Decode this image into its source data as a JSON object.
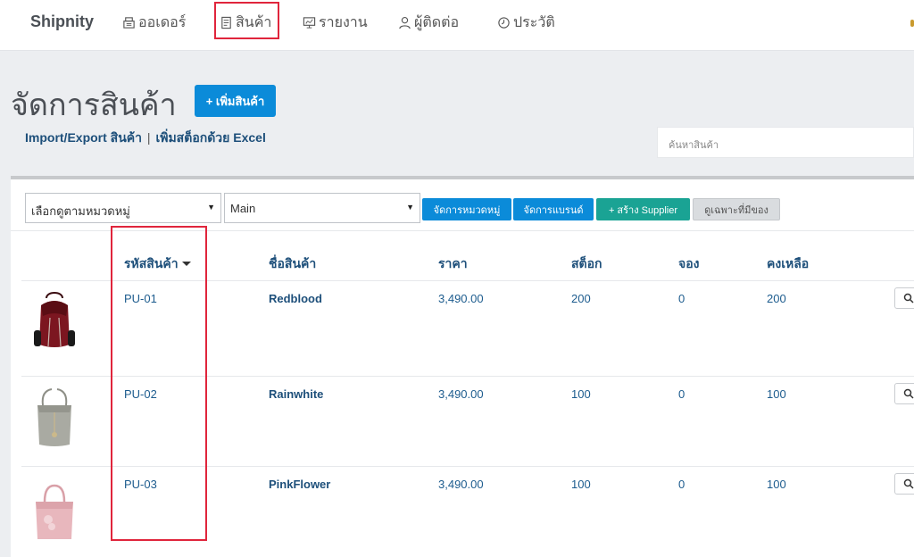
{
  "nav": {
    "brand": "Shipnity",
    "items": [
      {
        "label": "ออเดอร์",
        "icon": "cash-register-icon"
      },
      {
        "label": "สินค้า",
        "icon": "product-icon"
      },
      {
        "label": "รายงาน",
        "icon": "monitor-report-icon"
      },
      {
        "label": "ผู้ติดต่อ",
        "icon": "user-icon"
      },
      {
        "label": "ประวัติ",
        "icon": "history-icon"
      }
    ],
    "active_index": 1
  },
  "page": {
    "title": "จัดการสินค้า",
    "add_button": "+ เพิ่มสินค้า",
    "link_import": "Import/Export สินค้า",
    "link_separator": "|",
    "link_stock": "เพิ่มสต็อกด้วย Excel",
    "search_placeholder": "ค้นหาสินค้า"
  },
  "filters": {
    "category_select": "เลือกดูตามหมวดหมู่",
    "warehouse_select": "Main",
    "btn_manage_category": "จัดการหมวดหมู่",
    "btn_manage_brand": "จัดการแบรนด์",
    "btn_create_supplier": "+ สร้าง Supplier",
    "btn_in_stock_only": "ดูเฉพาะที่มีของ"
  },
  "colors": {
    "primary": "#0b8bd9",
    "teal": "#1aa394",
    "highlight": "#e0253c",
    "link": "#1d4f7a"
  },
  "table": {
    "headers": {
      "code": "รหัสสินค้า",
      "name": "ชื่อสินค้า",
      "price": "ราคา",
      "stock": "สต็อก",
      "reserved": "จอง",
      "remaining": "คงเหลือ"
    },
    "rows": [
      {
        "code": "PU-01",
        "name": "Redblood",
        "price": "3,490.00",
        "stock": "200",
        "reserved": "0",
        "remaining": "200",
        "image": "red-backpack"
      },
      {
        "code": "PU-02",
        "name": "Rainwhite",
        "price": "3,490.00",
        "stock": "100",
        "reserved": "0",
        "remaining": "100",
        "image": "grey-bucket-bag"
      },
      {
        "code": "PU-03",
        "name": "PinkFlower",
        "price": "3,490.00",
        "stock": "100",
        "reserved": "0",
        "remaining": "100",
        "image": "pink-handbag"
      }
    ]
  }
}
